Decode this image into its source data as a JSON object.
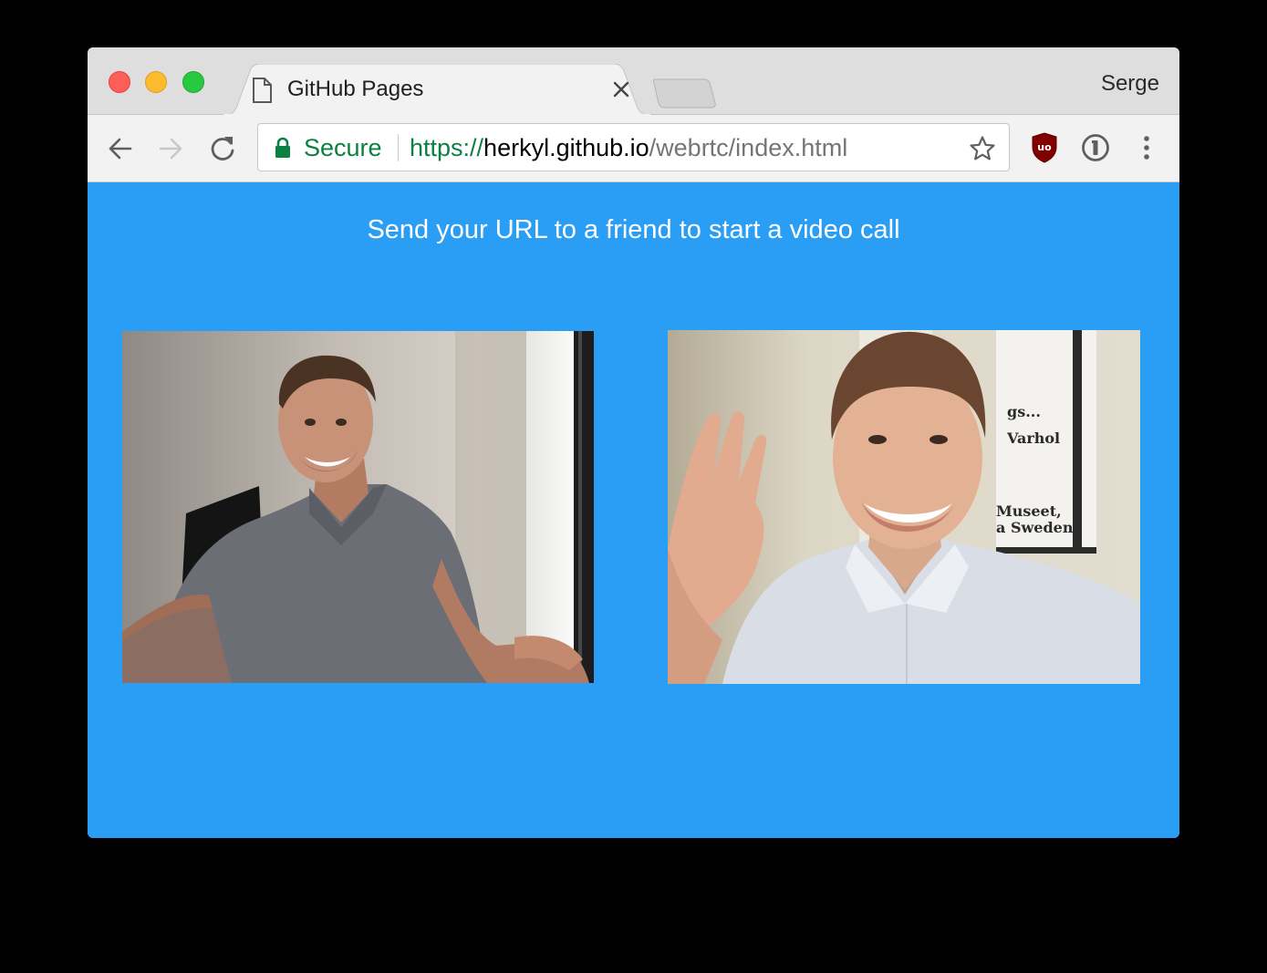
{
  "browser": {
    "tab": {
      "title": "GitHub Pages",
      "icon": "document-icon"
    },
    "profile_name": "Serge",
    "address_bar": {
      "security_label": "Secure",
      "url_scheme": "https://",
      "url_host": "herkyl.github.io",
      "url_path": "/webrtc/index.html"
    },
    "extensions": [
      "ublock-origin-icon",
      "onepassword-icon"
    ],
    "colors": {
      "secure_green": "#0b8043",
      "page_background": "#2a9df4"
    }
  },
  "page": {
    "message": "Send your URL to a friend to start a video call",
    "videos": [
      {
        "role": "local",
        "description_icon": "video-feed"
      },
      {
        "role": "remote",
        "description_icon": "video-feed"
      }
    ]
  }
}
